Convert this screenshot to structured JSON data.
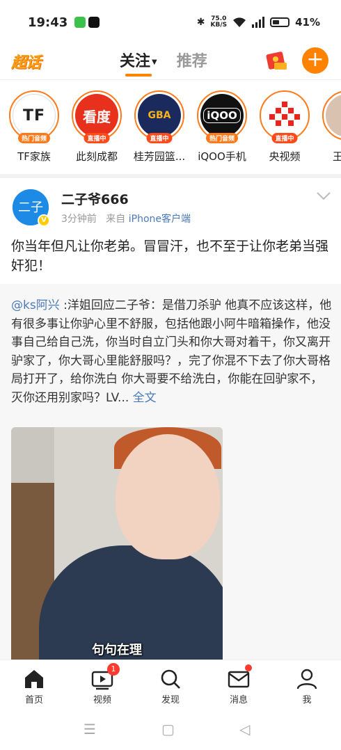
{
  "status": {
    "time": "19:43",
    "speed_value": "75.0",
    "speed_unit": "KB/S",
    "battery": "41%"
  },
  "topnav": {
    "logo": "超话",
    "tabs": [
      {
        "label": "关注",
        "active": true
      },
      {
        "label": "推荐",
        "active": false
      }
    ],
    "add_label": "+"
  },
  "stories": [
    {
      "name": "TF家族",
      "badge": "热门音频",
      "logo_text": "TF"
    },
    {
      "name": "此刻成都",
      "badge": "直播中",
      "logo_text": "看度"
    },
    {
      "name": "桂芳园篮...",
      "badge": "直播中",
      "logo_text": "GBA"
    },
    {
      "name": "iQOO手机",
      "badge": "热门音频",
      "logo_text": "iQOO"
    },
    {
      "name": "央视频",
      "badge": "直播中",
      "logo_text": ""
    },
    {
      "name": "王",
      "badge": "",
      "logo_text": ""
    }
  ],
  "post": {
    "username": "二子爷666",
    "time_ago": "3分钟前",
    "from_prefix": "来自",
    "source": "iPhone客户端",
    "text": "你当年但凡让你老弟。冒冒汗，也不至于让你老弟当强奸犯！",
    "quote": {
      "mention": "@ks阿兴",
      "body": " :洋姐回应二子爷：是借刀杀驴 他真不应该这样，他有很多事让你驴心里不舒服，包括他跟小阿牛暗箱操作，他没事自己给自己洗，你当时自立门头和你大哥对着干，你又离开驴家了，你大哥心里能舒服吗？，完了你混不下去了你大哥格局打开了，给你洗白 你大哥要不给洗白，你能在回驴家不，灭你还用别家吗？LV... ",
      "more": "全文"
    },
    "video_caption": "句句在理"
  },
  "bottomnav": [
    {
      "label": "首页",
      "icon": "home-icon"
    },
    {
      "label": "视频",
      "icon": "video-icon",
      "badge": "1"
    },
    {
      "label": "发现",
      "icon": "search-icon"
    },
    {
      "label": "消息",
      "icon": "mail-icon"
    },
    {
      "label": "我",
      "icon": "profile-icon"
    }
  ]
}
